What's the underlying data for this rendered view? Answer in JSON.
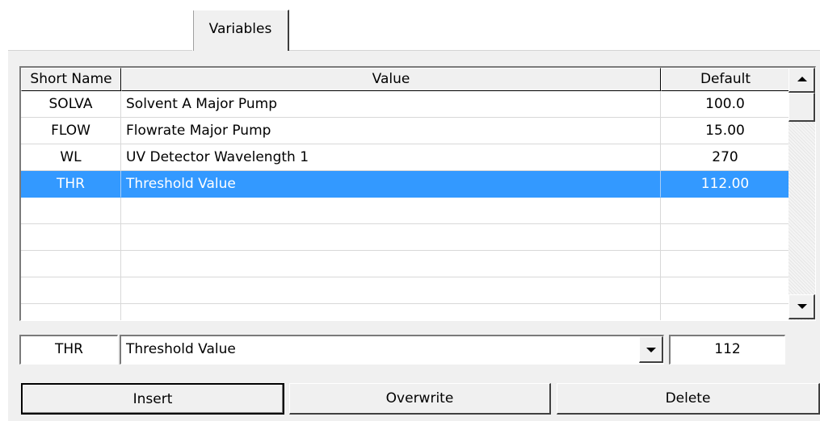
{
  "tabs": [
    {
      "label": "Variables"
    }
  ],
  "grid": {
    "columns": [
      "Short Name",
      "Value",
      "Default"
    ],
    "rows": [
      {
        "short": "SOLVA",
        "value": "Solvent A Major Pump",
        "default": "100.0"
      },
      {
        "short": "FLOW",
        "value": "Flowrate Major Pump",
        "default": "15.00"
      },
      {
        "short": "WL",
        "value": "UV Detector Wavelength 1",
        "default": "270"
      },
      {
        "short": "THR",
        "value": "Threshold Value",
        "default": "112.00",
        "selected": true
      }
    ],
    "empty_rows": 5
  },
  "editor": {
    "short_name": "THR",
    "value": "Threshold Value",
    "default": "112"
  },
  "buttons": {
    "insert": "Insert",
    "overwrite": "Overwrite",
    "delete": "Delete"
  },
  "colors": {
    "selection": "#3399ff",
    "panel": "#f0f0f0"
  }
}
